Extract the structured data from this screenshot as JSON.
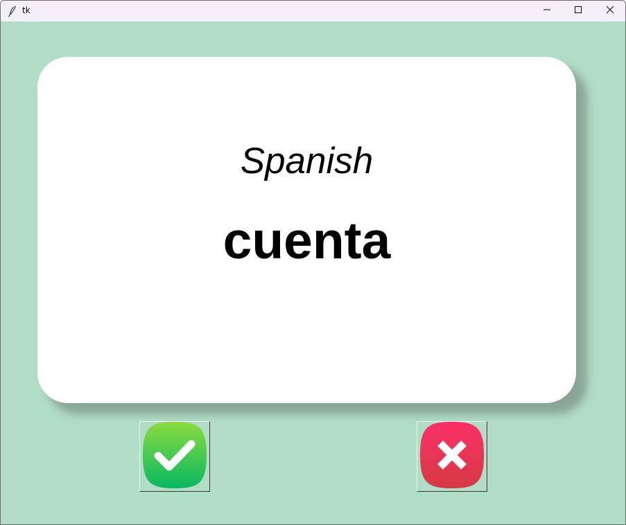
{
  "window": {
    "title": "tk",
    "app_icon": "feather-icon",
    "controls": [
      "minimize-icon",
      "maximize-icon",
      "close-icon"
    ]
  },
  "card": {
    "language": "Spanish",
    "word": "cuenta"
  },
  "buttons": {
    "right": {
      "icon": "checkmark-icon",
      "color_top": "#8bdc40",
      "color_bottom": "#07b861"
    },
    "wrong": {
      "icon": "x-icon",
      "color_top": "#fb3068",
      "color_bottom": "#d53a44"
    }
  },
  "colors": {
    "background": "#b1ddc6",
    "card": "#ffffff",
    "titlebar": "#f4eef7"
  }
}
